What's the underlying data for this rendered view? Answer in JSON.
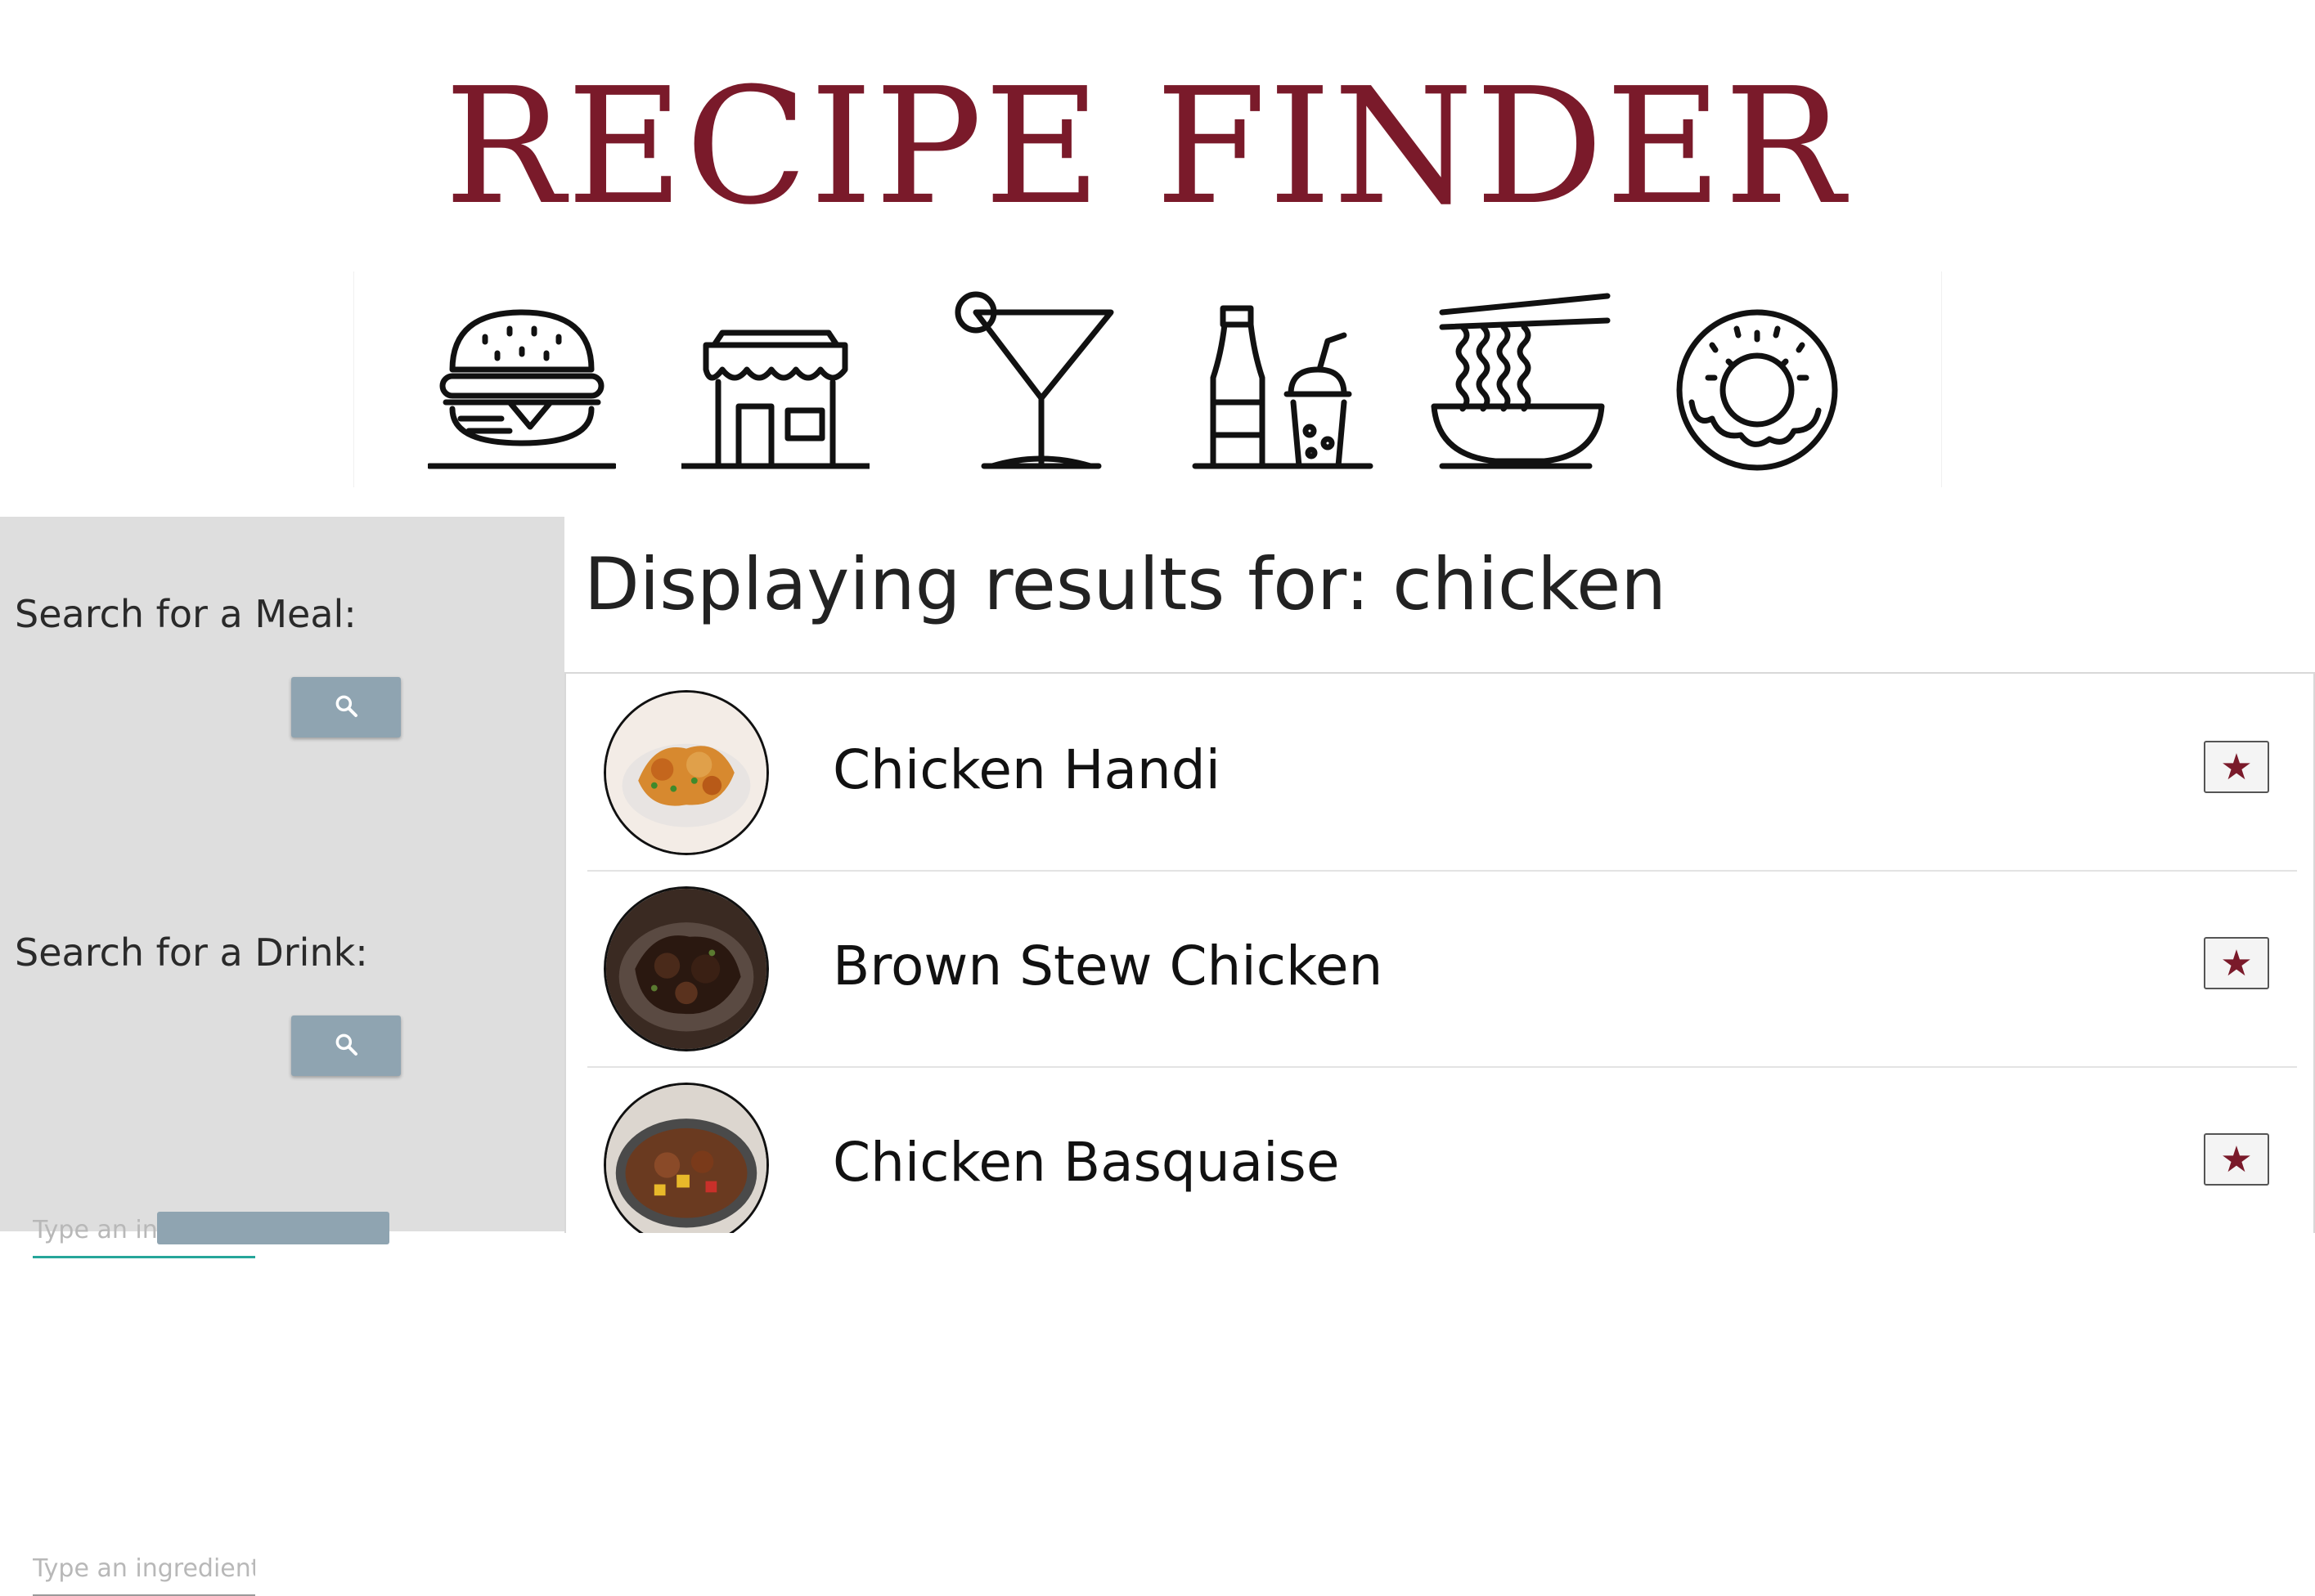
{
  "app": {
    "title": "RECIPE FINDER"
  },
  "icons": [
    "burger-icon",
    "storefront-icon",
    "cocktail-icon",
    "soda-drinks-icon",
    "noodle-bowl-icon",
    "donut-icon"
  ],
  "sidebar": {
    "meal_label": "Search for a Meal:",
    "meal_placeholder": "Type an ingredient",
    "drink_label": "Search for a Drink:",
    "drink_placeholder": "Type an ingredient"
  },
  "main": {
    "heading": "Displaying results for: chicken",
    "results": [
      {
        "name": "Chicken Handi"
      },
      {
        "name": "Brown Stew Chicken"
      },
      {
        "name": "Chicken Basquaise"
      }
    ]
  },
  "colors": {
    "brand": "#7a1a2a",
    "button": "#8fa4b1",
    "sidebar_bg": "#dedede",
    "input_focus": "#26a69a"
  }
}
